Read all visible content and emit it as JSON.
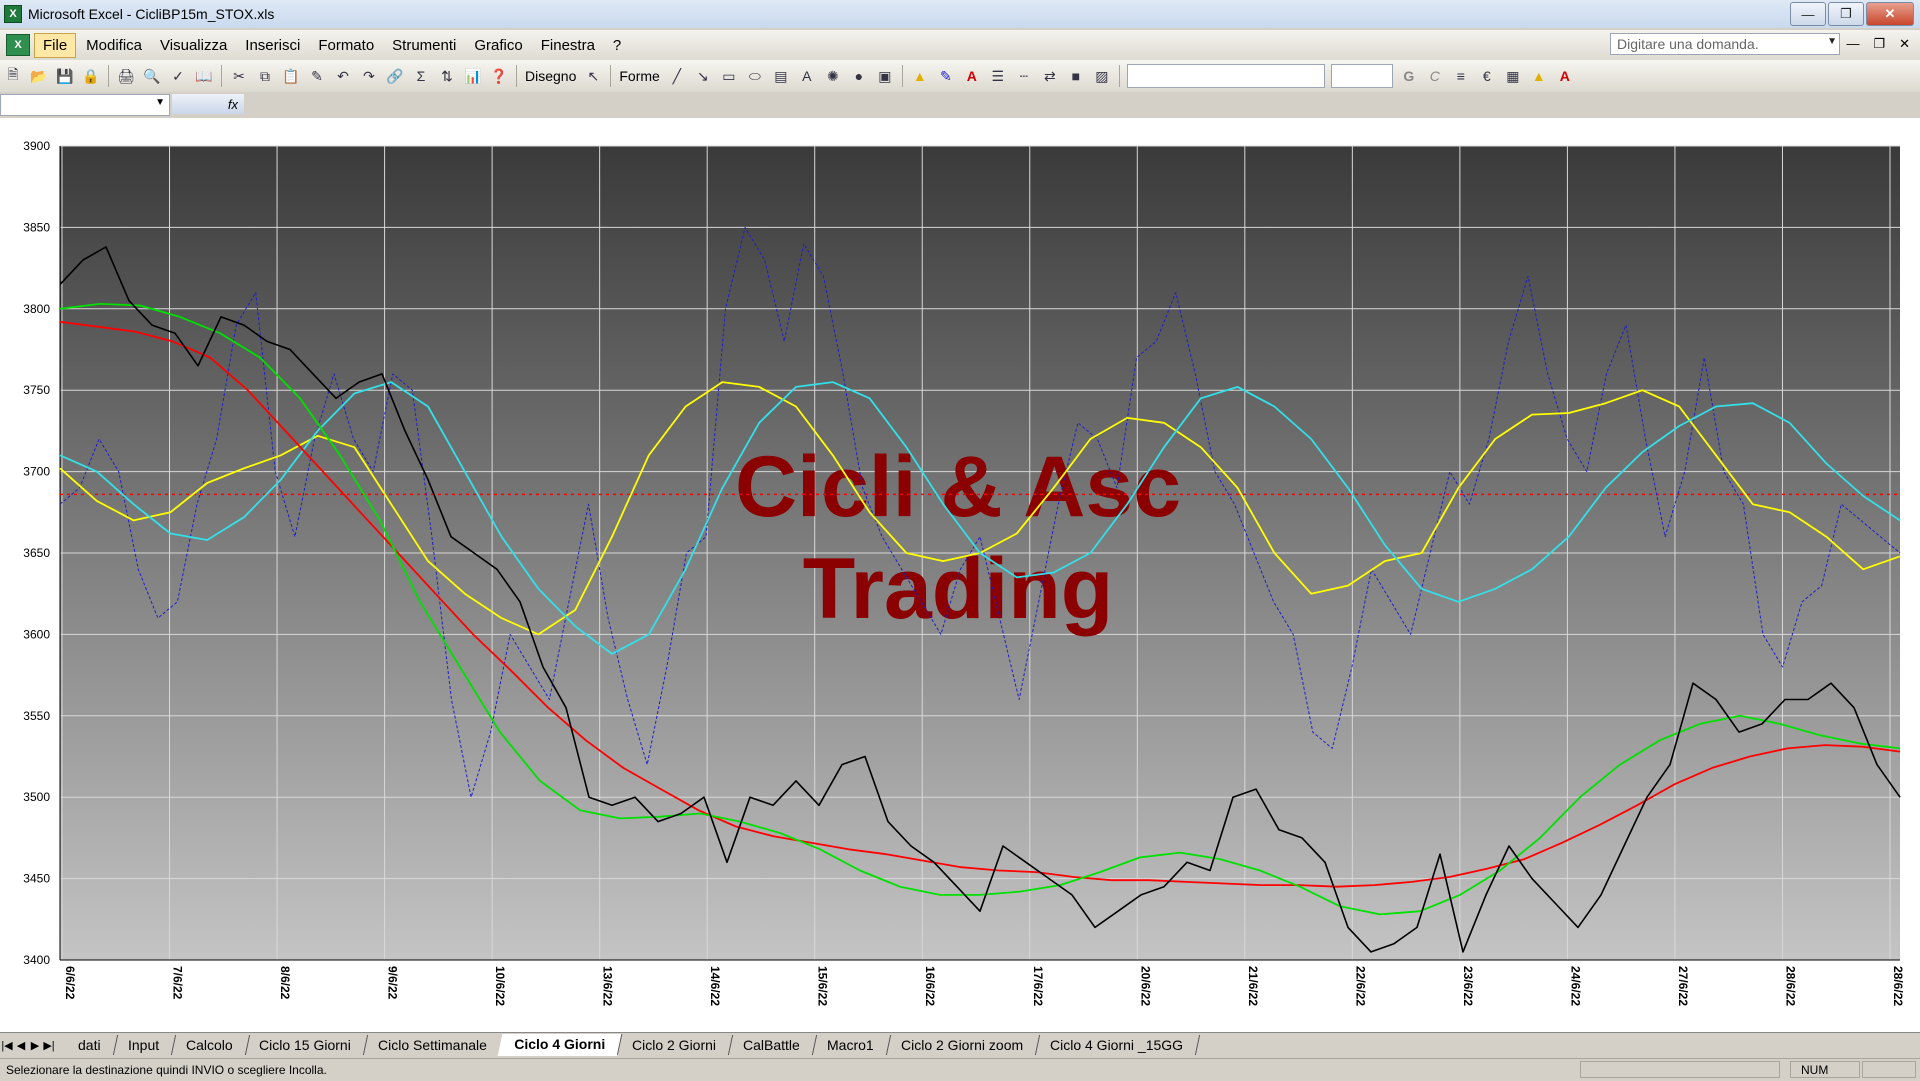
{
  "window": {
    "title": "Microsoft Excel - CicliBP15m_STOX.xls",
    "app_icon": "excel-icon"
  },
  "menu": {
    "items": [
      "File",
      "Modifica",
      "Visualizza",
      "Inserisci",
      "Formato",
      "Strumenti",
      "Grafico",
      "Finestra",
      "?"
    ],
    "active": "File",
    "ask_placeholder": "Digitare una domanda."
  },
  "toolbar": {
    "drawing_label": "Disegno",
    "shapes_label": "Forme",
    "bold": "G",
    "italic": "C"
  },
  "sheets": {
    "tabs": [
      "dati",
      "Input",
      "Calcolo",
      "Ciclo 15 Giorni",
      "Ciclo Settimanale",
      "Ciclo 4 Giorni",
      "Ciclo 2 Giorni",
      "CalBattle",
      "Macro1",
      "Ciclo 2 Giorni zoom",
      "Ciclo 4 Giorni _15GG"
    ],
    "active": "Ciclo 4 Giorni"
  },
  "status": {
    "message": "Selezionare la destinazione quindi INVIO o scegliere Incolla.",
    "num": "NUM"
  },
  "chart_data": {
    "type": "line",
    "watermark": [
      "Cicli & Asc",
      "Trading"
    ],
    "ylim": [
      3400,
      3900
    ],
    "yticks": [
      3400,
      3450,
      3500,
      3550,
      3600,
      3650,
      3700,
      3750,
      3800,
      3850,
      3900
    ],
    "x_dates": [
      "6/6/22",
      "7/6/22",
      "8/6/22",
      "9/6/22",
      "10/6/22",
      "13/6/22",
      "14/6/22",
      "15/6/22",
      "16/6/22",
      "17/6/22",
      "20/6/22",
      "21/6/22",
      "22/6/22",
      "23/6/22",
      "24/6/22",
      "27/6/22",
      "28/6/22",
      "28/6/22"
    ],
    "grid": true,
    "reference_line": {
      "value": 3686,
      "color": "#ff0000",
      "style": "dotted"
    },
    "series": [
      {
        "color": "#000000",
        "width": 1.6,
        "style": "solid",
        "values": [
          3815,
          3830,
          3838,
          3805,
          3790,
          3785,
          3765,
          3795,
          3790,
          3780,
          3775,
          3760,
          3745,
          3755,
          3760,
          3725,
          3695,
          3660,
          3650,
          3640,
          3620,
          3580,
          3555,
          3500,
          3495,
          3500,
          3485,
          3490,
          3500,
          3460,
          3500,
          3495,
          3510,
          3495,
          3520,
          3525,
          3485,
          3470,
          3460,
          3445,
          3430,
          3470,
          3460,
          3450,
          3440,
          3420,
          3430,
          3440,
          3445,
          3460,
          3455,
          3500,
          3505,
          3480,
          3475,
          3460,
          3420,
          3405,
          3410,
          3420,
          3465,
          3405,
          3440,
          3470,
          3450,
          3435,
          3420,
          3440,
          3470,
          3500,
          3520,
          3570,
          3560,
          3540,
          3545,
          3560,
          3560,
          3570,
          3555,
          3520,
          3500
        ]
      },
      {
        "color": "#ff0000",
        "width": 1.8,
        "style": "solid",
        "values": [
          3792,
          3789,
          3786,
          3780,
          3770,
          3750,
          3725,
          3700,
          3675,
          3650,
          3625,
          3600,
          3578,
          3555,
          3535,
          3518,
          3505,
          3492,
          3482,
          3476,
          3472,
          3468,
          3465,
          3461,
          3457,
          3455,
          3454,
          3451,
          3449,
          3449,
          3448,
          3447,
          3446,
          3446,
          3445,
          3446,
          3448,
          3451,
          3456,
          3462,
          3472,
          3483,
          3495,
          3508,
          3518,
          3525,
          3530,
          3532,
          3531,
          3528
        ]
      },
      {
        "color": "#00e000",
        "width": 1.8,
        "style": "solid",
        "values": [
          3800,
          3803,
          3802,
          3795,
          3785,
          3770,
          3745,
          3710,
          3670,
          3620,
          3580,
          3540,
          3510,
          3492,
          3487,
          3488,
          3490,
          3485,
          3478,
          3468,
          3455,
          3445,
          3440,
          3440,
          3442,
          3446,
          3454,
          3463,
          3466,
          3462,
          3455,
          3445,
          3433,
          3428,
          3430,
          3440,
          3455,
          3475,
          3500,
          3520,
          3535,
          3545,
          3550,
          3545,
          3538,
          3533,
          3530
        ]
      },
      {
        "color": "#ffff00",
        "width": 1.8,
        "style": "solid",
        "values": [
          3702,
          3682,
          3670,
          3675,
          3693,
          3702,
          3710,
          3722,
          3715,
          3680,
          3645,
          3625,
          3610,
          3600,
          3615,
          3660,
          3710,
          3740,
          3755,
          3752,
          3740,
          3710,
          3675,
          3650,
          3645,
          3650,
          3662,
          3690,
          3720,
          3733,
          3730,
          3715,
          3690,
          3650,
          3625,
          3630,
          3645,
          3650,
          3690,
          3720,
          3735,
          3736,
          3742,
          3750,
          3740,
          3710,
          3680,
          3675,
          3660,
          3640,
          3648
        ]
      },
      {
        "color": "#33e0e8",
        "width": 1.8,
        "style": "solid",
        "values": [
          3710,
          3700,
          3680,
          3662,
          3658,
          3672,
          3695,
          3725,
          3748,
          3755,
          3740,
          3700,
          3660,
          3628,
          3605,
          3588,
          3600,
          3640,
          3690,
          3730,
          3752,
          3755,
          3745,
          3715,
          3680,
          3650,
          3635,
          3638,
          3650,
          3680,
          3715,
          3745,
          3752,
          3740,
          3720,
          3690,
          3655,
          3628,
          3620,
          3628,
          3640,
          3660,
          3690,
          3712,
          3728,
          3740,
          3742,
          3730,
          3705,
          3685,
          3670
        ]
      },
      {
        "color": "#1f1fc8",
        "width": 1.0,
        "style": "dashed",
        "values": [
          3680,
          3690,
          3720,
          3700,
          3640,
          3610,
          3620,
          3680,
          3720,
          3790,
          3810,
          3700,
          3660,
          3720,
          3760,
          3720,
          3700,
          3760,
          3750,
          3660,
          3560,
          3500,
          3540,
          3600,
          3580,
          3560,
          3620,
          3680,
          3610,
          3560,
          3520,
          3580,
          3650,
          3660,
          3800,
          3850,
          3830,
          3780,
          3840,
          3820,
          3760,
          3690,
          3660,
          3640,
          3620,
          3600,
          3640,
          3660,
          3610,
          3560,
          3620,
          3680,
          3730,
          3720,
          3690,
          3770,
          3780,
          3810,
          3760,
          3700,
          3680,
          3650,
          3620,
          3600,
          3540,
          3530,
          3580,
          3640,
          3620,
          3600,
          3650,
          3700,
          3680,
          3720,
          3780,
          3820,
          3760,
          3720,
          3700,
          3760,
          3790,
          3720,
          3660,
          3700,
          3770,
          3700,
          3680,
          3600,
          3580,
          3620,
          3630,
          3680,
          3670,
          3660,
          3650
        ]
      }
    ]
  }
}
